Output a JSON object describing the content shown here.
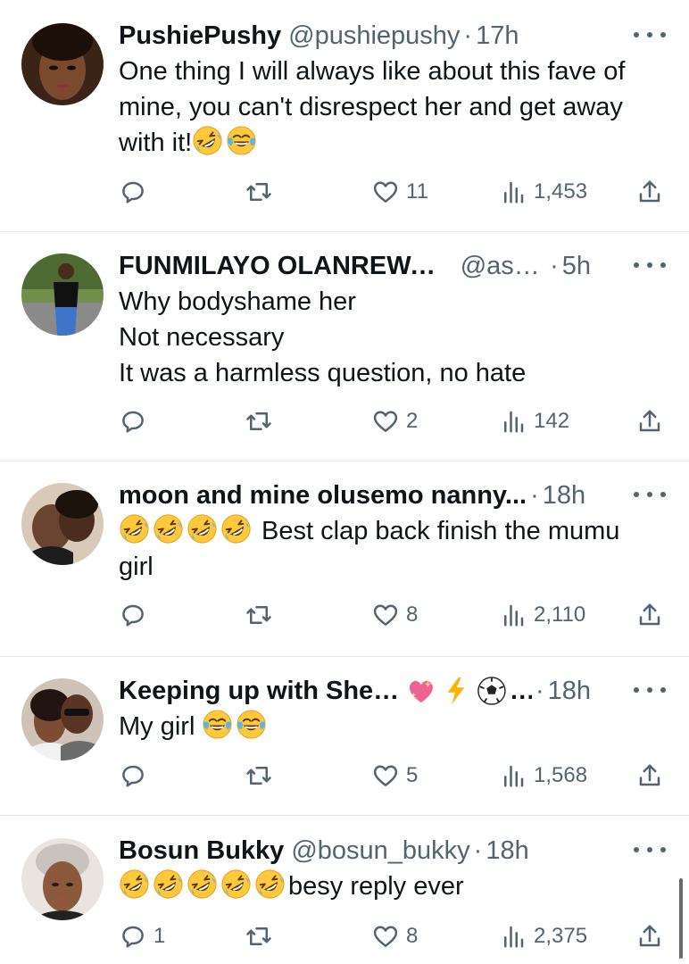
{
  "tweets": [
    {
      "name": "PushiePushy",
      "handle": "@pushiepushy",
      "time": "17h",
      "lines": [
        "One thing I will always like about this fave of",
        "mine, you can't disrespect her and get away"
      ],
      "line3_text": "with it!",
      "line3_emojis": [
        "rolling-on-floor-laughing-emoji",
        "tears-of-joy-emoji"
      ],
      "replies": "",
      "likes": "11",
      "views": "1,453"
    },
    {
      "name": "FUNMILAYO OLANREWAJU",
      "handle": "@ass...",
      "time": "5h",
      "lines": [
        "Why bodyshame her",
        "Not necessary",
        "It was a harmless question, no hate"
      ],
      "replies": "",
      "likes": "2",
      "views": "142"
    },
    {
      "name": "moon and mine olusemo nanny...",
      "handle": "",
      "time": "18h",
      "line1_emojis": [
        "rolling-on-floor-laughing-emoji",
        "rolling-on-floor-laughing-emoji",
        "rolling-on-floor-laughing-emoji",
        "rolling-on-floor-laughing-emoji"
      ],
      "line1_text": " Best clap back finish the mumu",
      "line2_text": "girl",
      "replies": "",
      "likes": "8",
      "views": "2,110"
    },
    {
      "name": "Keeping up with Shella",
      "name_suffix": "...",
      "name_emojis": [
        "sparkling-heart-emoji",
        "lightning-emoji",
        "soccer-ball-emoji"
      ],
      "handle": "",
      "time": "18h",
      "line1_text": "My girl",
      "line1_emojis": [
        "tears-of-joy-emoji",
        "tears-of-joy-emoji"
      ],
      "replies": "",
      "likes": "5",
      "views": "1,568"
    },
    {
      "name": "Bosun Bukky",
      "handle": "@bosun_bukky",
      "time": "18h",
      "line1_emojis": [
        "rolling-on-floor-laughing-emoji",
        "rolling-on-floor-laughing-emoji",
        "rolling-on-floor-laughing-emoji",
        "rolling-on-floor-laughing-emoji",
        "rolling-on-floor-laughing-emoji"
      ],
      "line1_text": "besy reply ever",
      "replies": "1",
      "likes": "8",
      "views": "2,375"
    }
  ],
  "separator_dot": "·",
  "colors": {
    "text": "#0f1419",
    "secondary": "#536471",
    "divider": "#e6e9ec",
    "emoji_yellow": "#ffc83d",
    "heart_pink": "#f06292",
    "lightning": "#ffb300"
  }
}
